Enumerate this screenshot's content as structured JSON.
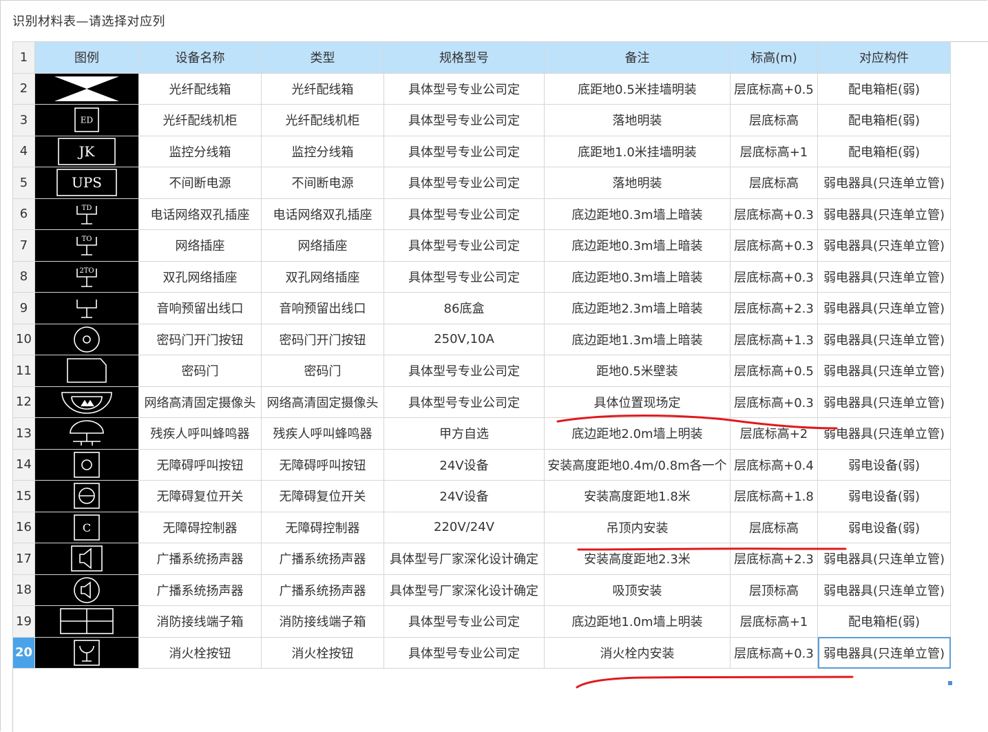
{
  "window": {
    "title": "识别材料表—请选择对应列"
  },
  "table": {
    "header_row_number": "1",
    "columns": [
      "图例",
      "设备名称",
      "类型",
      "规格型号",
      "备注",
      "标高(m)",
      "对应构件"
    ],
    "rows": [
      {
        "num": "2",
        "icon": "fiber-box-icon",
        "name": "光纤配线箱",
        "type": "光纤配线箱",
        "spec": "具体型号专业公司定",
        "note": "底距地0.5米挂墙明装",
        "elev": "层底标高+0.5",
        "comp": "配电箱柜(弱)"
      },
      {
        "num": "3",
        "icon": "ed-box-icon",
        "icon_text": "ED",
        "name": "光纤配线机柜",
        "type": "光纤配线机柜",
        "spec": "具体型号专业公司定",
        "note": "落地明装",
        "elev": "层底标高",
        "comp": "配电箱柜(弱)"
      },
      {
        "num": "4",
        "icon": "jk-box-icon",
        "icon_text": "JK",
        "name": "监控分线箱",
        "type": "监控分线箱",
        "spec": "具体型号专业公司定",
        "note": "底距地1.0米挂墙明装",
        "elev": "层底标高+1",
        "comp": "配电箱柜(弱)"
      },
      {
        "num": "5",
        "icon": "ups-box-icon",
        "icon_text": "UPS",
        "name": "不间断电源",
        "type": "不间断电源",
        "spec": "具体型号专业公司定",
        "note": "落地明装",
        "elev": "层底标高",
        "comp": "弱电器具(只连单立管)"
      },
      {
        "num": "6",
        "icon": "td-socket-icon",
        "icon_text": "TD",
        "name": "电话网络双孔插座",
        "type": "电话网络双孔插座",
        "spec": "具体型号专业公司定",
        "note": "底边距地0.3m墙上暗装",
        "elev": "层底标高+0.3",
        "comp": "弱电器具(只连单立管)"
      },
      {
        "num": "7",
        "icon": "to-socket-icon",
        "icon_text": "TO",
        "name": "网络插座",
        "type": "网络插座",
        "spec": "具体型号专业公司定",
        "note": "底边距地0.3m墙上暗装",
        "elev": "层底标高+0.3",
        "comp": "弱电器具(只连单立管)"
      },
      {
        "num": "8",
        "icon": "2to-socket-icon",
        "icon_text": "2TO",
        "name": "双孔网络插座",
        "type": "双孔网络插座",
        "spec": "具体型号专业公司定",
        "note": "底边距地0.3m墙上暗装",
        "elev": "层底标高+0.3",
        "comp": "弱电器具(只连单立管)"
      },
      {
        "num": "9",
        "icon": "audio-outlet-icon",
        "name": "音响预留出线口",
        "type": "音响预留出线口",
        "spec": "86底盒",
        "note": "底边距地2.3m墙上暗装",
        "elev": "层底标高+2.3",
        "comp": "弱电器具(只连单立管)"
      },
      {
        "num": "10",
        "icon": "door-button-icon",
        "name": "密码门开门按钮",
        "type": "密码门开门按钮",
        "spec": "250V,10A",
        "note": "底边距地1.3m墙上暗装",
        "elev": "层底标高+1.3",
        "comp": "弱电器具(只连单立管)"
      },
      {
        "num": "11",
        "icon": "code-door-icon",
        "name": "密码门",
        "type": "密码门",
        "spec": "具体型号专业公司定",
        "note": "距地0.5米壁装",
        "elev": "层底标高+0.5",
        "comp": "弱电器具(只连单立管)"
      },
      {
        "num": "12",
        "icon": "dome-camera-icon",
        "name": "网络高清固定摄像头",
        "type": "网络高清固定摄像头",
        "spec": "具体型号专业公司定",
        "note": "具体位置现场定",
        "elev": "层底标高+0.3",
        "comp": "弱电器具(只连单立管)"
      },
      {
        "num": "13",
        "icon": "buzzer-icon",
        "name": "残疾人呼叫蜂鸣器",
        "type": "残疾人呼叫蜂鸣器",
        "spec": "甲方自选",
        "note": "底边距地2.0m墙上明装",
        "elev": "层底标高+2",
        "comp": "弱电器具(只连单立管)"
      },
      {
        "num": "14",
        "icon": "call-button-icon",
        "name": "无障碍呼叫按钮",
        "type": "无障碍呼叫按钮",
        "spec": "24V设备",
        "note": "安装高度距地0.4m/0.8m各一个",
        "elev": "层底标高+0.4",
        "comp": "弱电设备(弱)"
      },
      {
        "num": "15",
        "icon": "reset-switch-icon",
        "name": "无障碍复位开关",
        "type": "无障碍复位开关",
        "spec": "24V设备",
        "note": "安装高度距地1.8米",
        "elev": "层底标高+1.8",
        "comp": "弱电设备(弱)"
      },
      {
        "num": "16",
        "icon": "controller-icon",
        "icon_text": "C",
        "name": "无障碍控制器",
        "type": "无障碍控制器",
        "spec": "220V/24V",
        "note": "吊顶内安装",
        "elev": "层底标高",
        "comp": "弱电设备(弱)"
      },
      {
        "num": "17",
        "icon": "wall-speaker-icon",
        "name": "广播系统扬声器",
        "type": "广播系统扬声器",
        "spec": "具体型号厂家深化设计确定",
        "note": "安装高度距地2.3米",
        "elev": "层底标高+2.3",
        "comp": "弱电器具(只连单立管)"
      },
      {
        "num": "18",
        "icon": "ceiling-speaker-icon",
        "name": "广播系统扬声器",
        "type": "广播系统扬声器",
        "spec": "具体型号厂家深化设计确定",
        "note": "吸顶安装",
        "elev": "层顶标高",
        "comp": "弱电器具(只连单立管)"
      },
      {
        "num": "19",
        "icon": "terminal-box-icon",
        "name": "消防接线端子箱",
        "type": "消防接线端子箱",
        "spec": "具体型号专业公司定",
        "note": "底边距地1.0m墙上明装",
        "elev": "层底标高+1",
        "comp": "配电箱柜(弱)"
      },
      {
        "num": "20",
        "icon": "hydrant-button-icon",
        "name": "消火栓按钮",
        "type": "消火栓按钮",
        "spec": "具体型号专业公司定",
        "note": "消火栓内安装",
        "elev": "层底标高+0.3",
        "comp": "弱电器具(只连单立管)"
      }
    ]
  },
  "colors": {
    "header_bg": "#bfe2fb",
    "row_number_bg": "#f2f2f2",
    "active_row_number_bg": "#4aa3e9",
    "legend_bg": "#000000",
    "annotation_red": "#e0191b"
  }
}
